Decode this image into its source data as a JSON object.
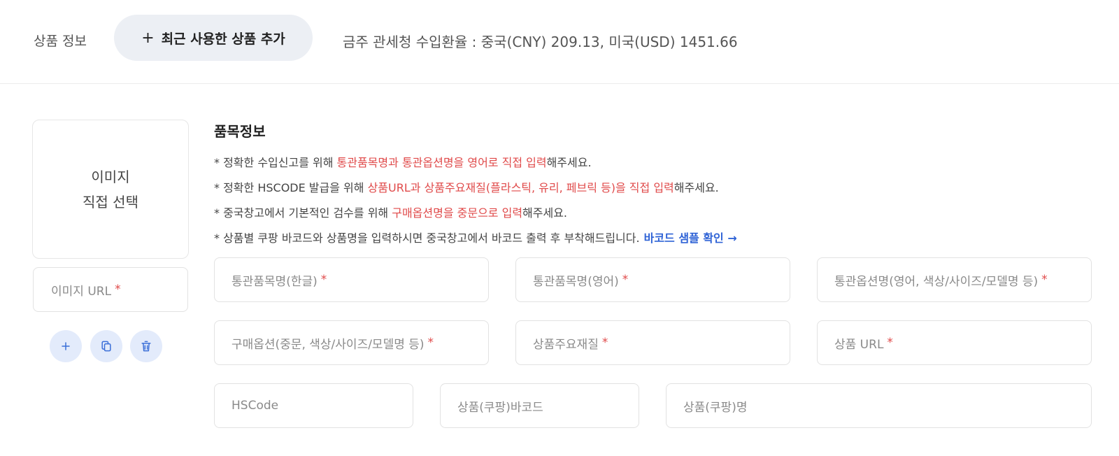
{
  "header": {
    "section_label": "상품 정보",
    "recent_button_icon": "+",
    "recent_button_label": "최근 사용한 상품 추가",
    "exchange_rate": "금주 관세청 수입환율 : 중국(CNY) 209.13, 미국(USD) 1451.66"
  },
  "image_panel": {
    "line1": "이미지",
    "line2": "직접 선택",
    "url_placeholder": "이미지 URL",
    "required_mark": "*",
    "actions": [
      "plus-icon",
      "copy-icon",
      "trash-icon"
    ]
  },
  "info": {
    "title": "품목정보",
    "notices": [
      {
        "prefix": "* 정확한 수입신고를 위해 ",
        "highlight": "통관품목명과 통관옵션명을 영어로 직접 입력",
        "suffix": "해주세요."
      },
      {
        "prefix": "* 정확한 HSCODE 발급을 위해 ",
        "highlight": "상품URL과 상품주요재질(플라스틱, 유리, 페브릭 등)을 직접 입력",
        "suffix": "해주세요."
      },
      {
        "prefix": "* 중국창고에서 기본적인 검수를 위해 ",
        "highlight": "구매옵션명을 중문으로 입력",
        "suffix": "해주세요."
      },
      {
        "prefix": "* 상품별 쿠팡 바코드와 상품명을 입력하시면 중국창고에서 바코드 출력 후 부착해드립니다.",
        "link": "바코드 샘플 확인 →"
      }
    ]
  },
  "fields": {
    "customs_name_kr": "통관품목명(한글)",
    "customs_name_en": "통관품목명(영어)",
    "customs_option_en": "통관옵션명(영어, 색상/사이즈/모델명 등)",
    "purchase_option": "구매옵션(중문, 색상/사이즈/모델명 등)",
    "main_material": "상품주요재질",
    "product_url": "상품 URL",
    "hscode": "HSCode",
    "coupang_barcode": "상품(쿠팡)바코드",
    "coupang_name": "상품(쿠팡)명",
    "required_mark": "*"
  },
  "colors": {
    "accent_blue": "#2f63d6",
    "required_red": "#e04a4a",
    "button_bg": "#eceff4",
    "icon_button_bg": "#e3ebfb"
  }
}
